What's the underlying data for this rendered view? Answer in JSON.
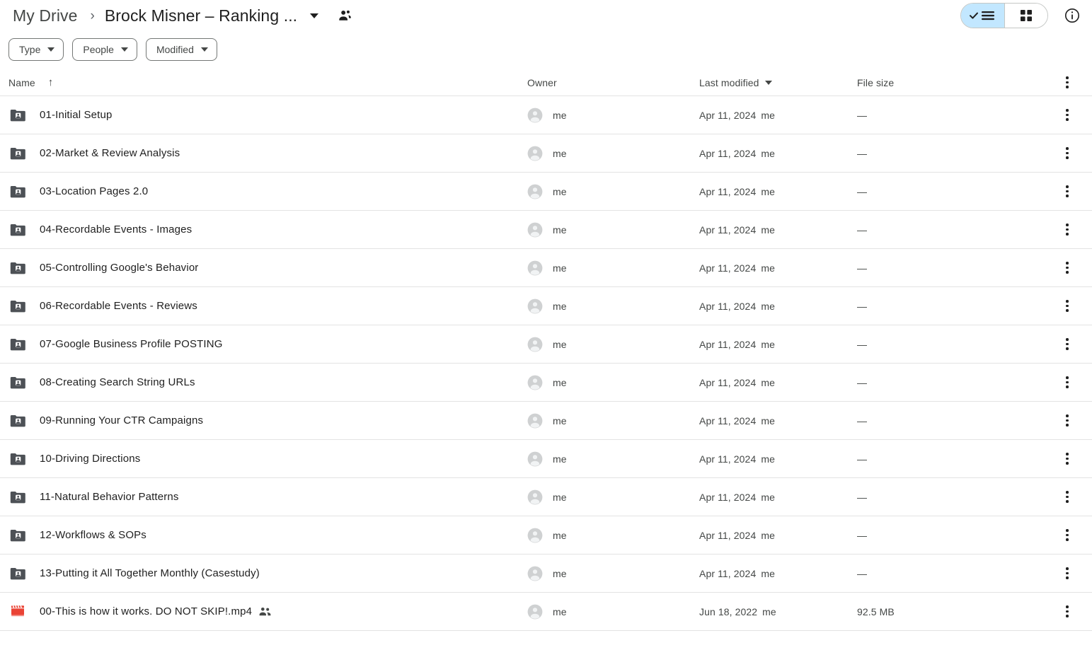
{
  "header": {
    "breadcrumb": {
      "root": "My Drive",
      "separator": "›",
      "current": "Brock Misner – Ranking ...",
      "dropdown_icon": "caret-down-icon",
      "share_icon": "shared-people-icon"
    },
    "view_toggle": {
      "list_label": "list-view",
      "grid_label": "grid-view",
      "active": "list-view"
    },
    "info_icon": "info-circle-icon",
    "accent_color": "#c2e7ff"
  },
  "filters": [
    {
      "label": "Type"
    },
    {
      "label": "People"
    },
    {
      "label": "Modified"
    }
  ],
  "table": {
    "columns": {
      "name": "Name",
      "name_sort": "↑",
      "owner": "Owner",
      "last_modified": "Last modified",
      "file_size": "File size"
    },
    "rows": [
      {
        "name": "01-Initial Setup",
        "icon": "shared-folder-icon",
        "shared": false,
        "owner": "me",
        "modified": "Apr 11, 2024",
        "modified_by": "me",
        "size": "—"
      },
      {
        "name": "02-Market & Review Analysis",
        "icon": "shared-folder-icon",
        "shared": false,
        "owner": "me",
        "modified": "Apr 11, 2024",
        "modified_by": "me",
        "size": "—"
      },
      {
        "name": "03-Location Pages 2.0",
        "icon": "shared-folder-icon",
        "shared": false,
        "owner": "me",
        "modified": "Apr 11, 2024",
        "modified_by": "me",
        "size": "—"
      },
      {
        "name": "04-Recordable Events - Images",
        "icon": "shared-folder-icon",
        "shared": false,
        "owner": "me",
        "modified": "Apr 11, 2024",
        "modified_by": "me",
        "size": "—"
      },
      {
        "name": "05-Controlling Google's Behavior",
        "icon": "shared-folder-icon",
        "shared": false,
        "owner": "me",
        "modified": "Apr 11, 2024",
        "modified_by": "me",
        "size": "—"
      },
      {
        "name": "06-Recordable Events - Reviews",
        "icon": "shared-folder-icon",
        "shared": false,
        "owner": "me",
        "modified": "Apr 11, 2024",
        "modified_by": "me",
        "size": "—"
      },
      {
        "name": "07-Google Business Profile POSTING",
        "icon": "shared-folder-icon",
        "shared": false,
        "owner": "me",
        "modified": "Apr 11, 2024",
        "modified_by": "me",
        "size": "—"
      },
      {
        "name": "08-Creating Search String URLs",
        "icon": "shared-folder-icon",
        "shared": false,
        "owner": "me",
        "modified": "Apr 11, 2024",
        "modified_by": "me",
        "size": "—"
      },
      {
        "name": "09-Running Your CTR Campaigns",
        "icon": "shared-folder-icon",
        "shared": false,
        "owner": "me",
        "modified": "Apr 11, 2024",
        "modified_by": "me",
        "size": "—"
      },
      {
        "name": "10-Driving Directions",
        "icon": "shared-folder-icon",
        "shared": false,
        "owner": "me",
        "modified": "Apr 11, 2024",
        "modified_by": "me",
        "size": "—"
      },
      {
        "name": "11-Natural Behavior Patterns",
        "icon": "shared-folder-icon",
        "shared": false,
        "owner": "me",
        "modified": "Apr 11, 2024",
        "modified_by": "me",
        "size": "—"
      },
      {
        "name": "12-Workflows & SOPs",
        "icon": "shared-folder-icon",
        "shared": false,
        "owner": "me",
        "modified": "Apr 11, 2024",
        "modified_by": "me",
        "size": "—"
      },
      {
        "name": "13-Putting it All Together Monthly (Casestudy)",
        "icon": "shared-folder-icon",
        "shared": false,
        "owner": "me",
        "modified": "Apr 11, 2024",
        "modified_by": "me",
        "size": "—"
      },
      {
        "name": "00-This is how it works. DO NOT SKIP!.mp4",
        "icon": "video-file-icon",
        "shared": true,
        "owner": "me",
        "modified": "Jun 18, 2022",
        "modified_by": "me",
        "size": "92.5 MB"
      }
    ],
    "row_menu_icon": "kebab-menu-icon",
    "folder_icon_color": "#4d5156",
    "video_icon_color": "#ea4335"
  }
}
